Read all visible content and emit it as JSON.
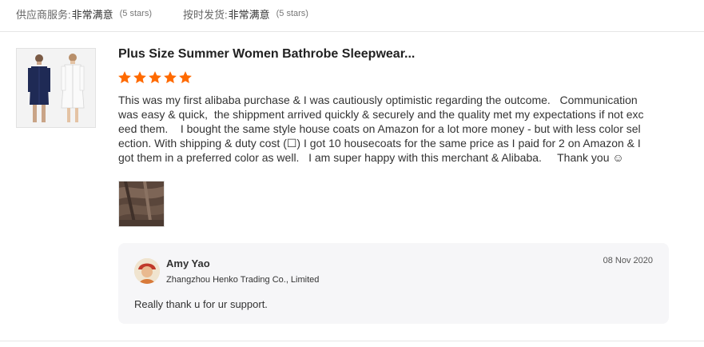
{
  "top_ratings": [
    {
      "label": "供应商服务:",
      "value": "非常满意",
      "stars": "(5 stars)"
    },
    {
      "label": "按时发货:",
      "value": "非常满意",
      "stars": "(5 stars)"
    }
  ],
  "review": {
    "product_title": "Plus Size Summer Women Bathrobe Sleepwear...",
    "rating": 5,
    "star_color": "#ff6a00",
    "text": "This was my first alibaba purchase & I was cautiously optimistic regarding the outcome.   Communication was easy & quick,  the shippment arrived quickly & securely and the quality met my expectations if not exceed them.    I bought the same style house coats on Amazon for a lot more money - but with less color selection. With shipping & duty cost (☐) I got 10 housecoats for the same price as I paid for 2 on Amazon & I got them in a preferred color as well.   I am super happy with this merchant & Alibaba.     Thank you ☺"
  },
  "reply": {
    "name": "Amy Yao",
    "company": "Zhangzhou Henko Trading Co., Limited",
    "date": "08 Nov 2020",
    "text": "Really thank u for ur support."
  }
}
